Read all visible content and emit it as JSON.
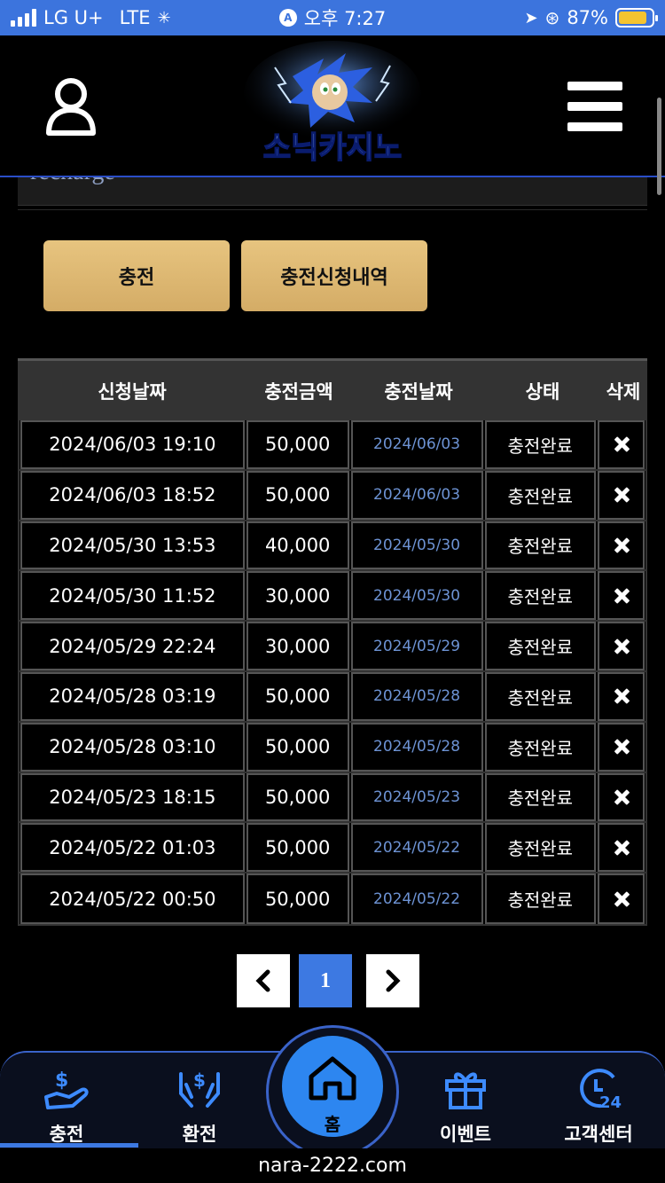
{
  "status_bar": {
    "carrier": "LG U+",
    "network": "LTE",
    "time": "오후 7:27",
    "battery": "87%",
    "battery_level": 0.87
  },
  "header": {
    "logo_text": "소닉카지노",
    "title_fragment": "recharge"
  },
  "buttons": {
    "charge": "충전",
    "history": "충전신청내역"
  },
  "table": {
    "headers": [
      "신청날짜",
      "충전금액",
      "충전날짜",
      "상태",
      "삭제"
    ],
    "rows": [
      {
        "request_date": "2024/06/03 19:10",
        "amount": "50,000",
        "charge_date": "2024/06/03",
        "status": "충전완료"
      },
      {
        "request_date": "2024/06/03 18:52",
        "amount": "50,000",
        "charge_date": "2024/06/03",
        "status": "충전완료"
      },
      {
        "request_date": "2024/05/30 13:53",
        "amount": "40,000",
        "charge_date": "2024/05/30",
        "status": "충전완료"
      },
      {
        "request_date": "2024/05/30 11:52",
        "amount": "30,000",
        "charge_date": "2024/05/30",
        "status": "충전완료"
      },
      {
        "request_date": "2024/05/29 22:24",
        "amount": "30,000",
        "charge_date": "2024/05/29",
        "status": "충전완료"
      },
      {
        "request_date": "2024/05/28 03:19",
        "amount": "50,000",
        "charge_date": "2024/05/28",
        "status": "충전완료"
      },
      {
        "request_date": "2024/05/28 03:10",
        "amount": "50,000",
        "charge_date": "2024/05/28",
        "status": "충전완료"
      },
      {
        "request_date": "2024/05/23 18:15",
        "amount": "50,000",
        "charge_date": "2024/05/23",
        "status": "충전완료"
      },
      {
        "request_date": "2024/05/22 01:03",
        "amount": "50,000",
        "charge_date": "2024/05/22",
        "status": "충전완료"
      },
      {
        "request_date": "2024/05/22 00:50",
        "amount": "50,000",
        "charge_date": "2024/05/22",
        "status": "충전완료"
      }
    ]
  },
  "pagination": {
    "current_page": "1"
  },
  "bottom_nav": {
    "items": [
      {
        "label": "충전",
        "icon": "charge-hand-icon"
      },
      {
        "label": "환전",
        "icon": "exchange-hands-icon"
      },
      {
        "label": "홈",
        "icon": "home-icon"
      },
      {
        "label": "이벤트",
        "icon": "gift-icon"
      },
      {
        "label": "고객센터",
        "icon": "support-24-icon"
      }
    ]
  },
  "url": "nara-2222.com",
  "colors": {
    "status_bar": "#3c74dd",
    "gold_button": "#e0bb74",
    "accent_blue": "#3d79e2",
    "charge_date_text": "#6d93d4"
  }
}
